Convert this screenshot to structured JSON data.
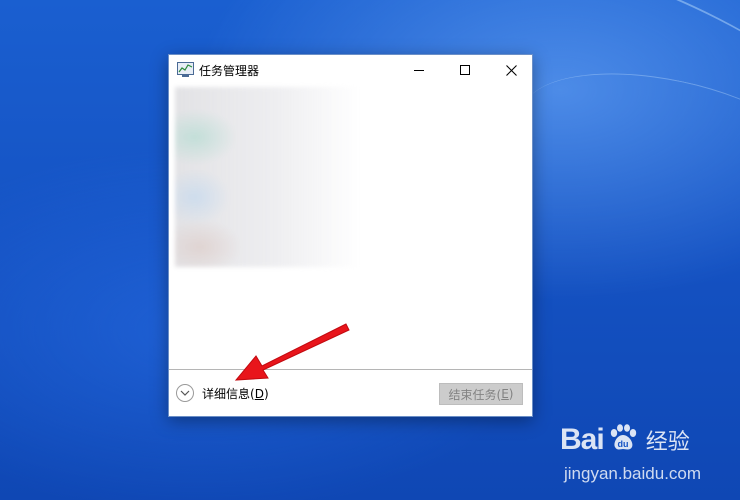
{
  "window": {
    "title": "任务管理器",
    "controls": {
      "minimize": "minimize",
      "maximize": "maximize",
      "close": "close"
    }
  },
  "footer": {
    "details_label": "详细信息(",
    "details_accel": "D",
    "details_suffix": ")",
    "end_task_label": "结束任务(",
    "end_task_accel": "E",
    "end_task_suffix": ")"
  },
  "annotation": {
    "color": "#e8151b"
  },
  "watermark": {
    "brand_left": "Bai",
    "brand_right": "u",
    "brand_cn": "经验",
    "url": "jingyan.baidu.com"
  },
  "colors": {
    "desktop": "#1553c4",
    "window_border": "#6b8fc7",
    "disabled_button": "#cccccc",
    "arrow": "#e8151b"
  }
}
